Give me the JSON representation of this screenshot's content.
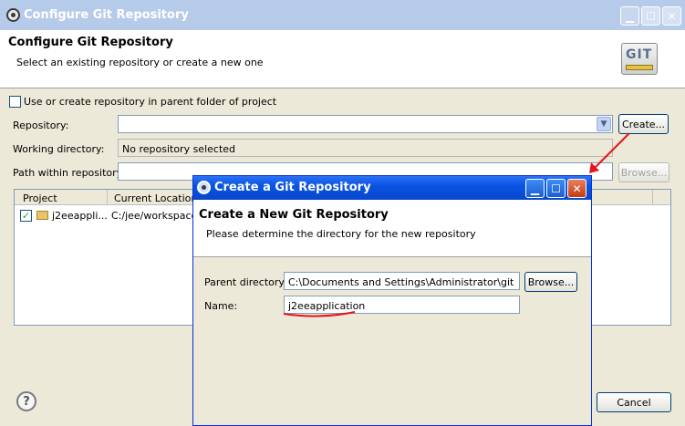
{
  "main_window": {
    "title": "Configure Git Repository",
    "header_title": "Configure Git Repository",
    "header_subtitle": "Select an existing repository or create a new one",
    "logo_text": "GIT",
    "parent_folder_checkbox": {
      "label": "Use or create repository in parent folder of project",
      "checked": false
    },
    "repository": {
      "label": "Repository:",
      "value": ""
    },
    "create_button": "Create...",
    "working_directory": {
      "label": "Working directory:",
      "value": "No repository selected"
    },
    "path_within": {
      "label": "Path within repository:",
      "value": ""
    },
    "browse_button": "Browse...",
    "table": {
      "columns": [
        "Project",
        "Current Location"
      ],
      "rows": [
        {
          "checked": true,
          "project": "j2eeappli...",
          "location": "C:/jee/workspace/"
        }
      ]
    },
    "help_icon": "?",
    "cancel_button": "Cancel"
  },
  "dialog": {
    "title": "Create a Git Repository",
    "header_title": "Create a New Git Repository",
    "header_subtitle": "Please determine the directory for the new repository",
    "parent_directory": {
      "label": "Parent directory:",
      "value": "C:\\Documents and Settings\\Administrator\\git"
    },
    "browse_button": "Browse...",
    "name": {
      "label": "Name:",
      "value": "j2eeapplication"
    }
  },
  "colors": {
    "annotation_red": "#e8141c",
    "xp_titlebar_blue": "#0a54e3",
    "inactive_titlebar": "#b6cbea"
  },
  "icons": [
    "eclipse-icon",
    "minimize-icon",
    "maximize-icon",
    "close-icon",
    "git-logo",
    "combo-arrow-icon",
    "checkbox-icon",
    "folder-icon",
    "help-icon"
  ]
}
